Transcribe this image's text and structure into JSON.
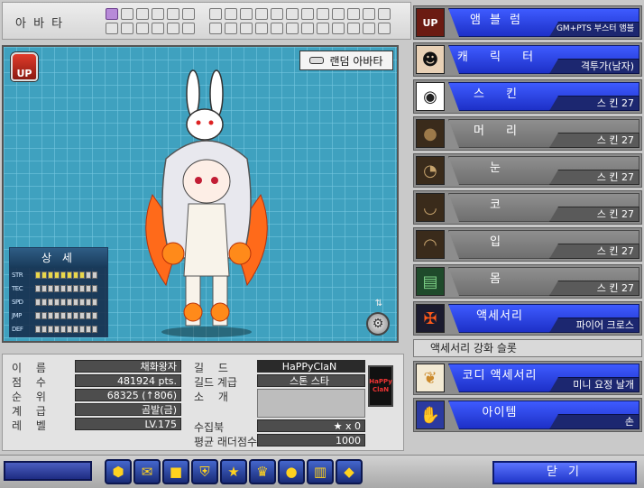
{
  "avatar": {
    "title": "아 바 타",
    "slots_top": [
      true,
      false,
      false,
      false,
      false,
      false,
      false,
      false,
      false,
      false,
      false,
      false,
      false,
      false
    ],
    "random_button": "랜덤 아바타",
    "logo_text": "UP",
    "detail": {
      "title": "상 세",
      "stats": [
        {
          "name": "STR",
          "filled": 8
        },
        {
          "name": "TEC",
          "filled": 0
        },
        {
          "name": "SPD",
          "filled": 0
        },
        {
          "name": "JMP",
          "filled": 0
        },
        {
          "name": "DEF",
          "filled": 0
        }
      ]
    }
  },
  "info": {
    "labels": {
      "name": "이   름",
      "score": "점   수",
      "rank": "순   위",
      "grade": "계   급",
      "level": "레   벨",
      "guild": "길   드",
      "guild_rank": "길드 계급",
      "intro": "소   개",
      "collection": "수집북",
      "ladder": "평균 래더점수"
    },
    "values": {
      "name": "채화왕자",
      "score": "481924 pts.",
      "rank": "68325 (↑806)",
      "grade": "곰발(금)",
      "level": "LV.175",
      "guild": "HaPPyClaN",
      "guild_rank": "스톤 스타",
      "intro": "",
      "collection": "★ x 0",
      "ladder": "1000"
    },
    "guild_emblem_text": "HaPPy ClaN"
  },
  "categories": [
    {
      "name": "앰블럼",
      "value": "GM+PTS 부스터 앰블럼",
      "style": "blue",
      "icon": "up-emblem-icon"
    },
    {
      "name": "캐 릭 터",
      "value": "격투가(남자)",
      "style": "blue",
      "icon": "fighter-portrait-icon"
    },
    {
      "name": "스 킨",
      "value": "스   킨 27",
      "style": "blue",
      "icon": "skin-icon"
    },
    {
      "name": "머 리",
      "value": "스   킨 27",
      "style": "gray",
      "icon": "hair-icon"
    },
    {
      "name": "눈",
      "value": "스   킨 27",
      "style": "gray",
      "icon": "eyes-icon"
    },
    {
      "name": "코",
      "value": "스   킨 27",
      "style": "gray",
      "icon": "nose-icon"
    },
    {
      "name": "입",
      "value": "스   킨 27",
      "style": "gray",
      "icon": "mouth-icon"
    },
    {
      "name": "몸",
      "value": "스   킨 27",
      "style": "gray",
      "icon": "body-icon"
    },
    {
      "name": "액세서리",
      "value": "파이어 크로스",
      "style": "blue",
      "icon": "fire-cross-icon"
    }
  ],
  "accessory_enhance_slot": "액세서리 강화 슬롯",
  "codi": {
    "name": "코디 액세서리",
    "value": "미니 요정 날개",
    "icon": "fairy-wing-icon"
  },
  "item": {
    "name": "아이템",
    "value": "손",
    "icon": "hand-icon"
  },
  "toolbar": {
    "icons": [
      "hexagon-icon",
      "chat-icon",
      "box-icon",
      "shield-icon",
      "star-icon",
      "bag-icon",
      "lock-icon",
      "chart-icon",
      "card-icon"
    ],
    "close_label": "닫 기"
  }
}
